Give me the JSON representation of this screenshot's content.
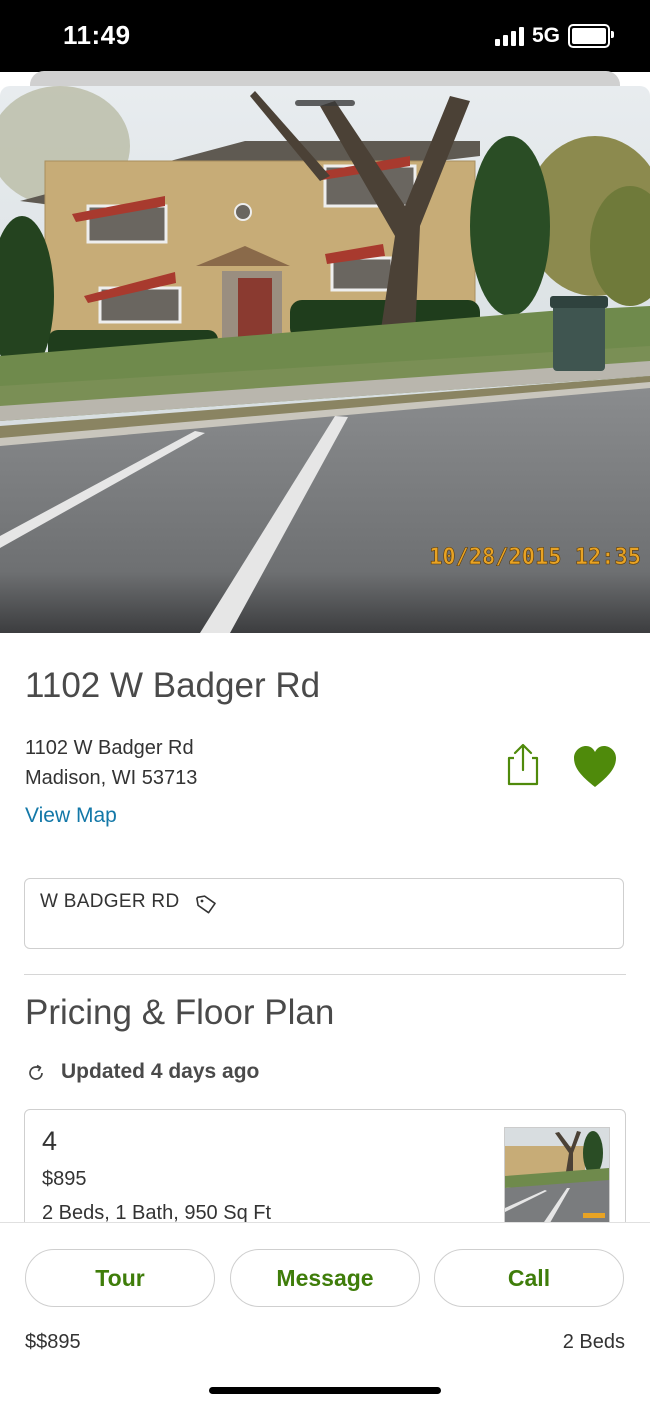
{
  "status_bar": {
    "time": "11:49",
    "network": "5G"
  },
  "photo": {
    "timestamp": "10/28/2015 12:35"
  },
  "listing": {
    "title": "1102 W Badger Rd",
    "address_line1": "1102 W Badger Rd",
    "address_line2": "Madison, WI 53713",
    "view_map": "View Map",
    "favorited": true
  },
  "tag": {
    "label": "W BADGER RD"
  },
  "pricing": {
    "section_title": "Pricing & Floor Plan",
    "updated": "Updated 4 days ago",
    "units": [
      {
        "name": "4",
        "price": "$895",
        "details": "2 Beds, 1 Bath, 950 Sq Ft"
      }
    ]
  },
  "actions": {
    "tour": "Tour",
    "message": "Message",
    "call": "Call"
  },
  "footer": {
    "price": "$$895",
    "beds": "2 Beds"
  },
  "colors": {
    "accent_green": "#3f7d0a",
    "heart_green": "#4f8a0b",
    "link_blue": "#1378a8"
  },
  "icons": {
    "share": "share-icon",
    "favorite": "heart-icon",
    "tag": "tag-icon",
    "refresh": "refresh-icon"
  }
}
